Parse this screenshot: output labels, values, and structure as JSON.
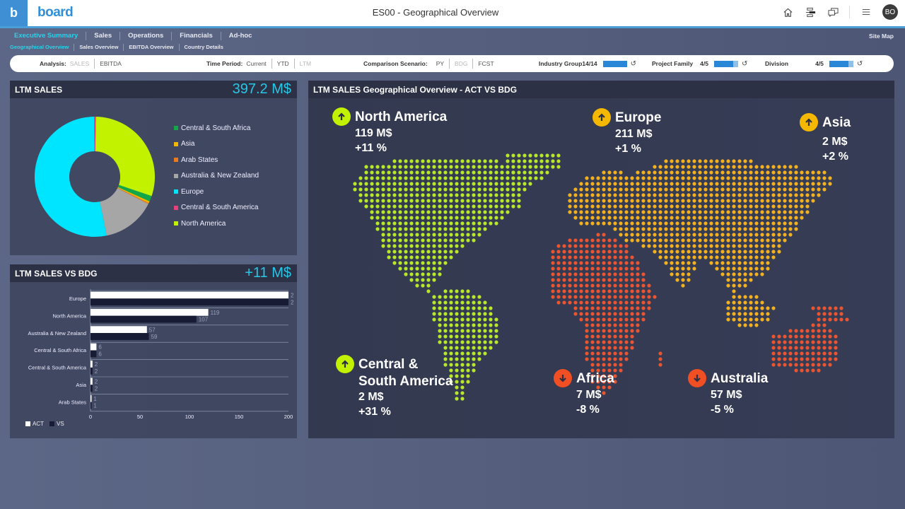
{
  "app": {
    "logo_letter": "b",
    "brand": "board",
    "title": "ES00 - Geographical Overview",
    "user_initials": "BO",
    "icons": [
      "home-icon",
      "panel-toggle-icon",
      "chat-icon",
      "menu-icon"
    ]
  },
  "nav": {
    "primary": [
      "Executive Summary",
      "Sales",
      "Operations",
      "Financials",
      "Ad-hoc"
    ],
    "secondary": [
      "Geographical Overview",
      "Sales Overview",
      "EBITDA Overview",
      "Country Details"
    ],
    "active_primary": "Executive Summary",
    "active_secondary": "Geographical Overview",
    "site_map": "Site Map"
  },
  "filters": {
    "analysis": {
      "label": "Analysis:",
      "options": [
        "SALES",
        "EBITDA"
      ],
      "selected": "SALES"
    },
    "time_period": {
      "label": "Time Period:",
      "options": [
        "Current",
        "YTD",
        "LTM"
      ],
      "selected": "LTM"
    },
    "comparison": {
      "label": "Comparison Scenario:",
      "options": [
        "PY",
        "BDG",
        "FCST"
      ],
      "selected": "BDG"
    },
    "industry_group": {
      "label": "Industry Group",
      "count": "14/14",
      "fill": 1.0
    },
    "project_family": {
      "label": "Project Family",
      "count": "4/5",
      "fill": 0.8
    },
    "division": {
      "label": "Division",
      "count": "4/5",
      "fill": 0.8
    }
  },
  "colors": {
    "accent": "#27c7e6",
    "up_green": "#c3f200",
    "up_amber": "#f5b800",
    "down_red": "#f04e23",
    "north_america_dots": "#b8e62a",
    "eurasia_dots": "#f0b020",
    "africa_oceania_dots": "#e85530"
  },
  "ltm_sales": {
    "title": "LTM SALES",
    "total": "397.2 M$"
  },
  "ltm_vs_bdg": {
    "title": "LTM SALES VS BDG",
    "delta": "+11 M$"
  },
  "map": {
    "title": "LTM SALES Geographical Overview - ACT  VS BDG",
    "regions": [
      {
        "name": "North America",
        "value": "119 M$",
        "change": "+11 %",
        "direction": "up",
        "color": "#c3f200"
      },
      {
        "name": "Europe",
        "value": "211 M$",
        "change": "+1 %",
        "direction": "up",
        "color": "#f5b800"
      },
      {
        "name": "Asia",
        "value": "2 M$",
        "change": "+2 %",
        "direction": "up",
        "color": "#f5b800"
      },
      {
        "name_line1": "Central &",
        "name_line2": "South America",
        "value": "2 M$",
        "change": "+31 %",
        "direction": "up",
        "color": "#c3f200"
      },
      {
        "name": "Africa",
        "value": "7 M$",
        "change": "-8 %",
        "direction": "down",
        "color": "#f04e23"
      },
      {
        "name": "Australia",
        "value": "57 M$",
        "change": "-5 %",
        "direction": "down",
        "color": "#f04e23"
      }
    ]
  },
  "chart_data": [
    {
      "type": "pie",
      "title": "LTM SALES",
      "donut": true,
      "categories": [
        "Central & South Africa",
        "Asia",
        "Arab States",
        "Australia & New Zealand",
        "Europe",
        "Central & South America",
        "North America"
      ],
      "values": [
        6,
        2,
        1,
        57,
        211,
        2,
        119
      ],
      "colors": [
        "#12a84a",
        "#f5b800",
        "#f07a18",
        "#a6a6a6",
        "#00e5ff",
        "#e8417a",
        "#c3f200"
      ],
      "legend": "right"
    },
    {
      "type": "bar",
      "orientation": "horizontal",
      "title": "LTM SALES VS BDG",
      "categories": [
        "Europe",
        "North America",
        "Australia & New Zealand",
        "Central & South Africa",
        "Central & South America",
        "Asia",
        "Arab States"
      ],
      "series": [
        {
          "name": "ACT",
          "values": [
            211,
            119,
            57,
            6,
            2,
            2,
            1
          ],
          "labels": [
            "2",
            "119",
            "57",
            "6",
            "2",
            "2",
            "1"
          ],
          "color": "#ffffff"
        },
        {
          "name": "VS",
          "values": [
            209,
            107,
            59,
            6,
            2,
            2,
            1
          ],
          "labels": [
            "2",
            "107",
            "59",
            "6",
            "2",
            "2",
            "1"
          ],
          "color": "#171b33"
        }
      ],
      "xlim": [
        0,
        200
      ],
      "xticks": [
        0,
        50,
        100,
        150,
        200
      ],
      "grid": true,
      "legend": "bottom-left"
    }
  ]
}
